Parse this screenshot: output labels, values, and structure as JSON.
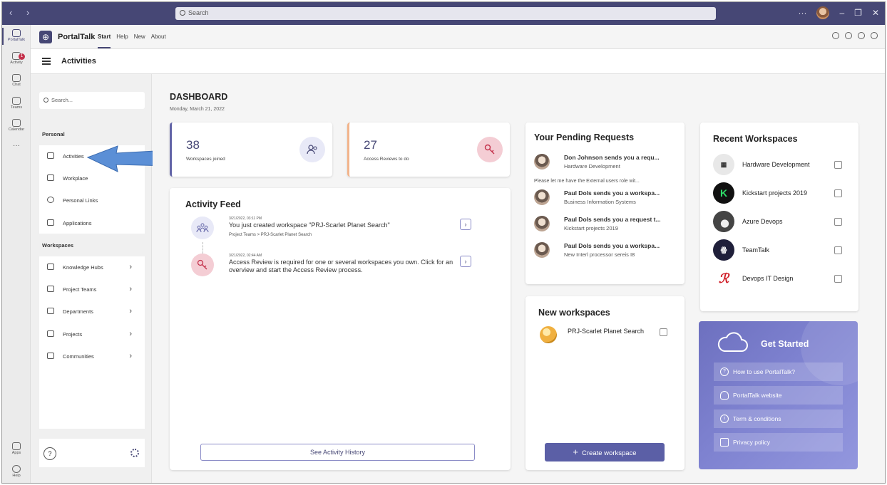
{
  "titlebar": {
    "search_placeholder": "Search",
    "more": "···",
    "window_controls": [
      "–",
      "❐",
      "✕"
    ]
  },
  "rail": {
    "items": [
      {
        "label": "PortalTalk",
        "icon": "portaltalk-icon",
        "active": true
      },
      {
        "label": "Activity",
        "icon": "bell-icon",
        "badge": "1"
      },
      {
        "label": "Chat",
        "icon": "chat-icon"
      },
      {
        "label": "Teams",
        "icon": "teams-icon"
      },
      {
        "label": "Calendar",
        "icon": "calendar-icon"
      },
      {
        "label": "···",
        "icon": "more-icon"
      }
    ],
    "bottom": [
      {
        "label": "Apps",
        "icon": "apps-icon"
      },
      {
        "label": "Help",
        "icon": "help-icon"
      }
    ]
  },
  "app": {
    "name": "PortalTalk",
    "tabs": [
      "Start",
      "Help",
      "New",
      "About"
    ]
  },
  "page": {
    "title": "Activities"
  },
  "sidebar": {
    "search_placeholder": "Search...",
    "personal_heading": "Personal",
    "personal_items": [
      "Activities",
      "Workplace",
      "Personal Links",
      "Applications"
    ],
    "workspaces_heading": "Workspaces",
    "workspace_items": [
      "Knowledge Hubs",
      "Project Teams",
      "Departments",
      "Projects",
      "Communities"
    ],
    "help": "?"
  },
  "dashboard": {
    "title": "DASHBOARD",
    "date": "Monday, March 21, 2022",
    "stats": [
      {
        "value": "38",
        "label": "Workspaces joined",
        "icon": "people-icon"
      },
      {
        "value": "27",
        "label": "Access Reviews to do",
        "icon": "key-icon"
      }
    ]
  },
  "feed": {
    "title": "Activity Feed",
    "items": [
      {
        "timestamp": "3/21/2022, 03:11 PM",
        "text": "You just created workspace \"PRJ-Scarlet Planet Search\"",
        "path": "Project Teams > PRJ-Scarlet Planet Search"
      },
      {
        "timestamp": "3/21/2022, 02:44 AM",
        "text": "Access Review is required for one or several workspaces you own. Click for an overview and start the Access Review process.",
        "path": ""
      }
    ],
    "history_button": "See Activity History"
  },
  "requests": {
    "title": "Your Pending Requests",
    "items": [
      {
        "title": "Don Johnson sends you a requ...",
        "sub": "Hardware Development"
      },
      {
        "title": "Paul Dols sends you a workspa...",
        "sub": "Business Information Systems"
      },
      {
        "title": "Paul Dols sends you a request t...",
        "sub": "Kickstart projects 2019"
      },
      {
        "title": "Paul Dols sends you a workspa...",
        "sub": "New Interl processor sereis I8"
      }
    ],
    "message": "Please let me have the External users role wit..."
  },
  "new_workspaces": {
    "title": "New workspaces",
    "items": [
      "PRJ-Scarlet Planet Search"
    ],
    "create_button": "Create workspace",
    "create_icon": "+"
  },
  "recent": {
    "title": "Recent Workspaces",
    "items": [
      {
        "name": "Hardware Development",
        "logo": "hardware-logo",
        "bg": "#e8e8e8"
      },
      {
        "name": "Kickstart projects 2019",
        "logo": "K",
        "bg": "#111111"
      },
      {
        "name": "Azure Devops",
        "logo": "azure-logo",
        "bg": "#555555"
      },
      {
        "name": "TeamTalk",
        "logo": "teamtalk-logo",
        "bg": "#1f1f3a"
      },
      {
        "name": "Devops IT Design",
        "logo": "devops-logo",
        "bg": "#ffffff"
      }
    ]
  },
  "get_started": {
    "title": "Get Started",
    "links": [
      {
        "label": "How to use PortalTalk?",
        "icon": "question-icon",
        "glyph": "?"
      },
      {
        "label": "PortalTalk website",
        "icon": "cloud-icon",
        "glyph": ""
      },
      {
        "label": "Term & conditions",
        "icon": "info-icon",
        "glyph": "i"
      },
      {
        "label": "Privacy policy",
        "icon": "lock-icon",
        "glyph": ""
      }
    ]
  },
  "colors": {
    "brand": "#464775",
    "accent": "#5b5fa6",
    "key_pink": "#c4314b"
  }
}
